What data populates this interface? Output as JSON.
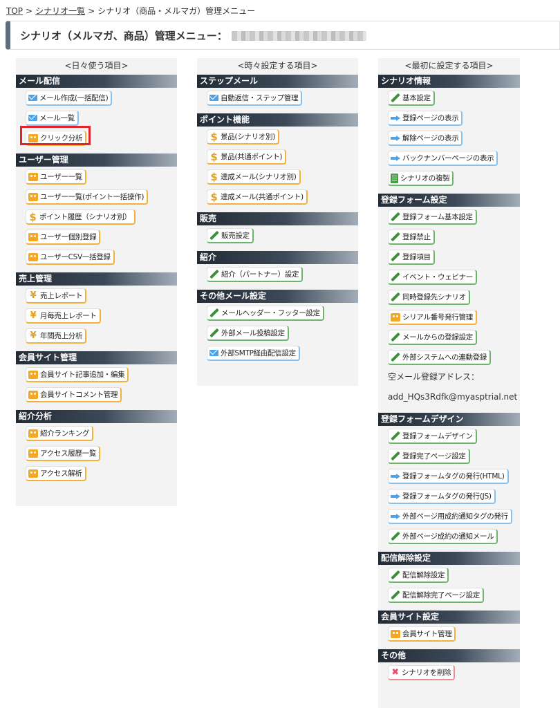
{
  "breadcrumb": {
    "top": "TOP",
    "list": "シナリオ一覧",
    "current": "シナリオ（商品・メルマガ）管理メニュー",
    "separator": ">"
  },
  "header": {
    "title": "シナリオ（メルマガ、商品）管理メニュー："
  },
  "columns": [
    {
      "title": "<日々使う項目>",
      "sections": [
        {
          "title": "メール配信",
          "items": [
            {
              "label": "メール作成(一括配信)",
              "icon": "mail"
            },
            {
              "label": "メール一覧",
              "icon": "mail"
            },
            {
              "label": "クリック分析",
              "icon": "ppl",
              "highlighted": true
            }
          ]
        },
        {
          "title": "ユーザー管理",
          "items": [
            {
              "label": "ユーザー一覧",
              "icon": "ppl"
            },
            {
              "label": "ユーザー一覧(ポイント一括操作)",
              "icon": "ppl"
            },
            {
              "label": "ポイント履歴（シナリオ別）",
              "icon": "dol"
            },
            {
              "label": "ユーザー個別登録",
              "icon": "ppl"
            },
            {
              "label": "ユーザーCSV一括登録",
              "icon": "ppl"
            }
          ]
        },
        {
          "title": "売上管理",
          "items": [
            {
              "label": "売上レポート",
              "icon": "yen"
            },
            {
              "label": "月毎売上レポート",
              "icon": "yen"
            },
            {
              "label": "年間売上分析",
              "icon": "yen"
            }
          ]
        },
        {
          "title": "会員サイト管理",
          "items": [
            {
              "label": "会員サイト記事追加・編集",
              "icon": "ppl"
            },
            {
              "label": "会員サイトコメント管理",
              "icon": "ppl"
            }
          ]
        },
        {
          "title": "紹介分析",
          "items": [
            {
              "label": "紹介ランキング",
              "icon": "ppl"
            },
            {
              "label": "アクセス履歴一覧",
              "icon": "ppl"
            },
            {
              "label": "アクセス解析",
              "icon": "ppl"
            }
          ]
        }
      ]
    },
    {
      "title": "<時々設定する項目>",
      "sections": [
        {
          "title": "ステップメール",
          "items": [
            {
              "label": "自動返信・ステップ管理",
              "icon": "mail"
            }
          ]
        },
        {
          "title": "ポイント機能",
          "items": [
            {
              "label": "景品(シナリオ別)",
              "icon": "dol"
            },
            {
              "label": "景品(共通ポイント)",
              "icon": "dol"
            },
            {
              "label": "達成メール(シナリオ別)",
              "icon": "dol"
            },
            {
              "label": "達成メール(共通ポイント)",
              "icon": "dol"
            }
          ]
        },
        {
          "title": "販売",
          "items": [
            {
              "label": "販売設定",
              "icon": "pen"
            }
          ]
        },
        {
          "title": "紹介",
          "items": [
            {
              "label": "紹介（パートナー）設定",
              "icon": "pen"
            }
          ]
        },
        {
          "title": "その他メール設定",
          "items": [
            {
              "label": "メールヘッダー・フッター設定",
              "icon": "pen"
            },
            {
              "label": "外部メール投稿設定",
              "icon": "pen"
            },
            {
              "label": "外部SMTP経由配信設定",
              "icon": "mail"
            }
          ]
        }
      ]
    },
    {
      "title": "<最初に設定する項目>",
      "sections": [
        {
          "title": "シナリオ情報",
          "items": [
            {
              "label": "基本設定",
              "icon": "pen"
            },
            {
              "label": "登録ページの表示",
              "icon": "arr"
            },
            {
              "label": "解除ページの表示",
              "icon": "arr"
            },
            {
              "label": "バックナンバーページの表示",
              "icon": "arr"
            },
            {
              "label": "シナリオの複製",
              "icon": "doc"
            }
          ]
        },
        {
          "title": "登録フォーム設定",
          "items": [
            {
              "label": "登録フォーム基本設定",
              "icon": "pen"
            },
            {
              "label": "登録禁止",
              "icon": "pen"
            },
            {
              "label": "登録項目",
              "icon": "pen"
            },
            {
              "label": "イベント・ウェビナー",
              "icon": "pen"
            },
            {
              "label": "同時登録先シナリオ",
              "icon": "pen"
            },
            {
              "label": "シリアル番号発行管理",
              "icon": "ppl"
            },
            {
              "label": "メールからの登録設定",
              "icon": "pen"
            },
            {
              "label": "外部システムへの連動登録",
              "icon": "pen"
            }
          ],
          "texts": [
            "空メール登録アドレス：",
            "add_HQs3Rdfk@myasptrial.net"
          ]
        },
        {
          "title": "登録フォームデザイン",
          "items": [
            {
              "label": "登録フォームデザイン",
              "icon": "pen"
            },
            {
              "label": "登録完了ページ設定",
              "icon": "pen"
            },
            {
              "label": "登録フォームタグの発行(HTML)",
              "icon": "arr"
            },
            {
              "label": "登録フォームタグの発行(JS)",
              "icon": "arr"
            },
            {
              "label": "外部ページ用成約通知タグの発行",
              "icon": "arr"
            },
            {
              "label": "外部ページ成約の通知メール",
              "icon": "pen"
            }
          ]
        },
        {
          "title": "配信解除設定",
          "items": [
            {
              "label": "配信解除設定",
              "icon": "pen"
            },
            {
              "label": "配信解除完了ページ設定",
              "icon": "pen"
            }
          ]
        },
        {
          "title": "会員サイト設定",
          "items": [
            {
              "label": "会員サイト管理",
              "icon": "ppl"
            }
          ]
        },
        {
          "title": "その他",
          "items": [
            {
              "label": "シナリオを削除",
              "icon": "del"
            }
          ]
        }
      ]
    }
  ],
  "icon_names": {
    "mail": "envelope-icon",
    "ppl": "users-icon",
    "yen": "yen-icon",
    "dol": "dollar-icon",
    "pen": "pencil-icon",
    "arr": "arrow-right-icon",
    "doc": "document-icon",
    "del": "delete-x-icon"
  },
  "colors": {
    "section_bar": "#2b3540",
    "highlight_box": "#e0242c",
    "column_bg": "#f3f3f3"
  }
}
